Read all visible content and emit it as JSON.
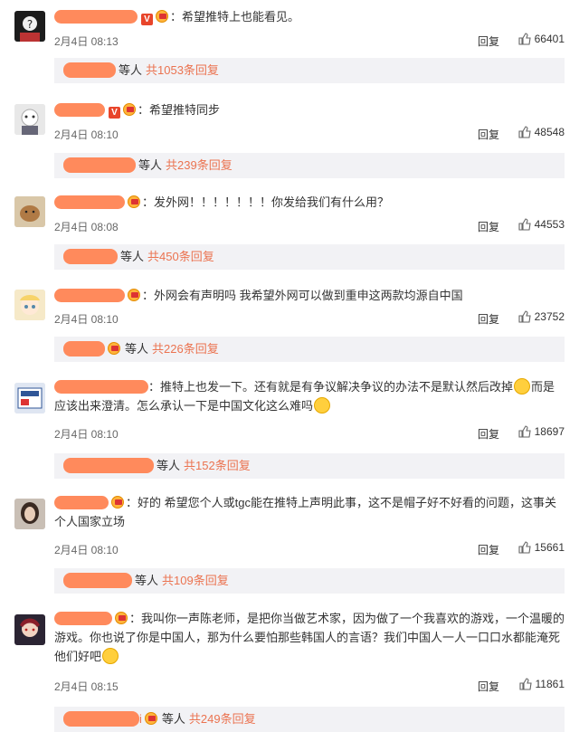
{
  "colors": {
    "accent": "#eb7350",
    "redaction": "#ff8a5c",
    "subbox_bg": "#f2f2f5"
  },
  "labels": {
    "reply": "回复",
    "others": "等人"
  },
  "comments": [
    {
      "text": "：希望推特上也能看见。",
      "date": "2月4日 08:13",
      "likes": "66401",
      "sub_count": "共1053条回复",
      "verified": true
    },
    {
      "text": "：希望推特同步",
      "date": "2月4日 08:10",
      "likes": "48548",
      "sub_count": "共239条回复",
      "verified": true
    },
    {
      "text": "：发外网！！！！！！！你发给我们有什么用？",
      "date": "2月4日 08:08",
      "likes": "44553",
      "sub_count": "共450条回复",
      "verified": false
    },
    {
      "text": "：外网会有声明吗 我希望外网可以做到重申这两款均源自中国",
      "date": "2月4日 08:10",
      "likes": "23752",
      "sub_count": "共226条回复",
      "verified": false
    },
    {
      "text_a": "：推特上也发一下。还有就是有争议解决争议的办法不是默认然后改掉",
      "text_b": "而是应该出来澄清。怎么承认一下是中国文化这么难吗",
      "date": "2月4日 08:10",
      "likes": "18697",
      "sub_count": "共152条回复",
      "verified": false
    },
    {
      "text": "：好的 希望您个人或tgc能在推特上声明此事，这不是帽子好不好看的问题，这事关个人国家立场",
      "date": "2月4日 08:10",
      "likes": "15661",
      "sub_count": "共109条回复",
      "verified": false
    },
    {
      "text": "：我叫你一声陈老师，是把你当做艺术家，因为做了一个我喜欢的游戏，一个温暖的游戏。你也说了你是中国人，那为什么要怕那些韩国人的言语？我们中国人一人一口口水都能淹死他们好吧",
      "date": "2月4日 08:15",
      "likes": "11861",
      "sub_count": "共249条回复",
      "sub_name_tail": "i",
      "verified": false
    }
  ]
}
